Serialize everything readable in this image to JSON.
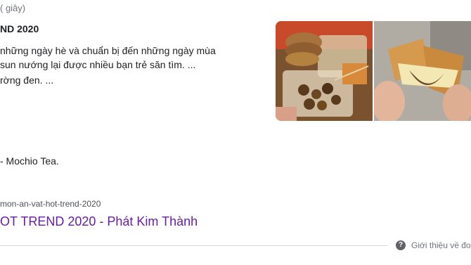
{
  "search_stats": "( giây)",
  "featured_snippet": {
    "title": "ND 2020",
    "lines": [
      "những ngày hè và chuẩn bị đến những ngày mùa",
      "sun nướng lại được nhiều bạn trẻ săn tìm. ...",
      "rờng đen. ...",
      "- Mochio Tea."
    ]
  },
  "images": [
    {
      "icon": "image-grilled-skewers"
    },
    {
      "icon": "image-toasted-sandwich"
    }
  ],
  "source": {
    "url": "mon-an-vat-hot-trend-2020",
    "title": "OT TREND 2020 - Phát Kim Thành"
  },
  "footer": {
    "about_label": "Giới thiệu về đoạn",
    "help_glyph": "?"
  }
}
